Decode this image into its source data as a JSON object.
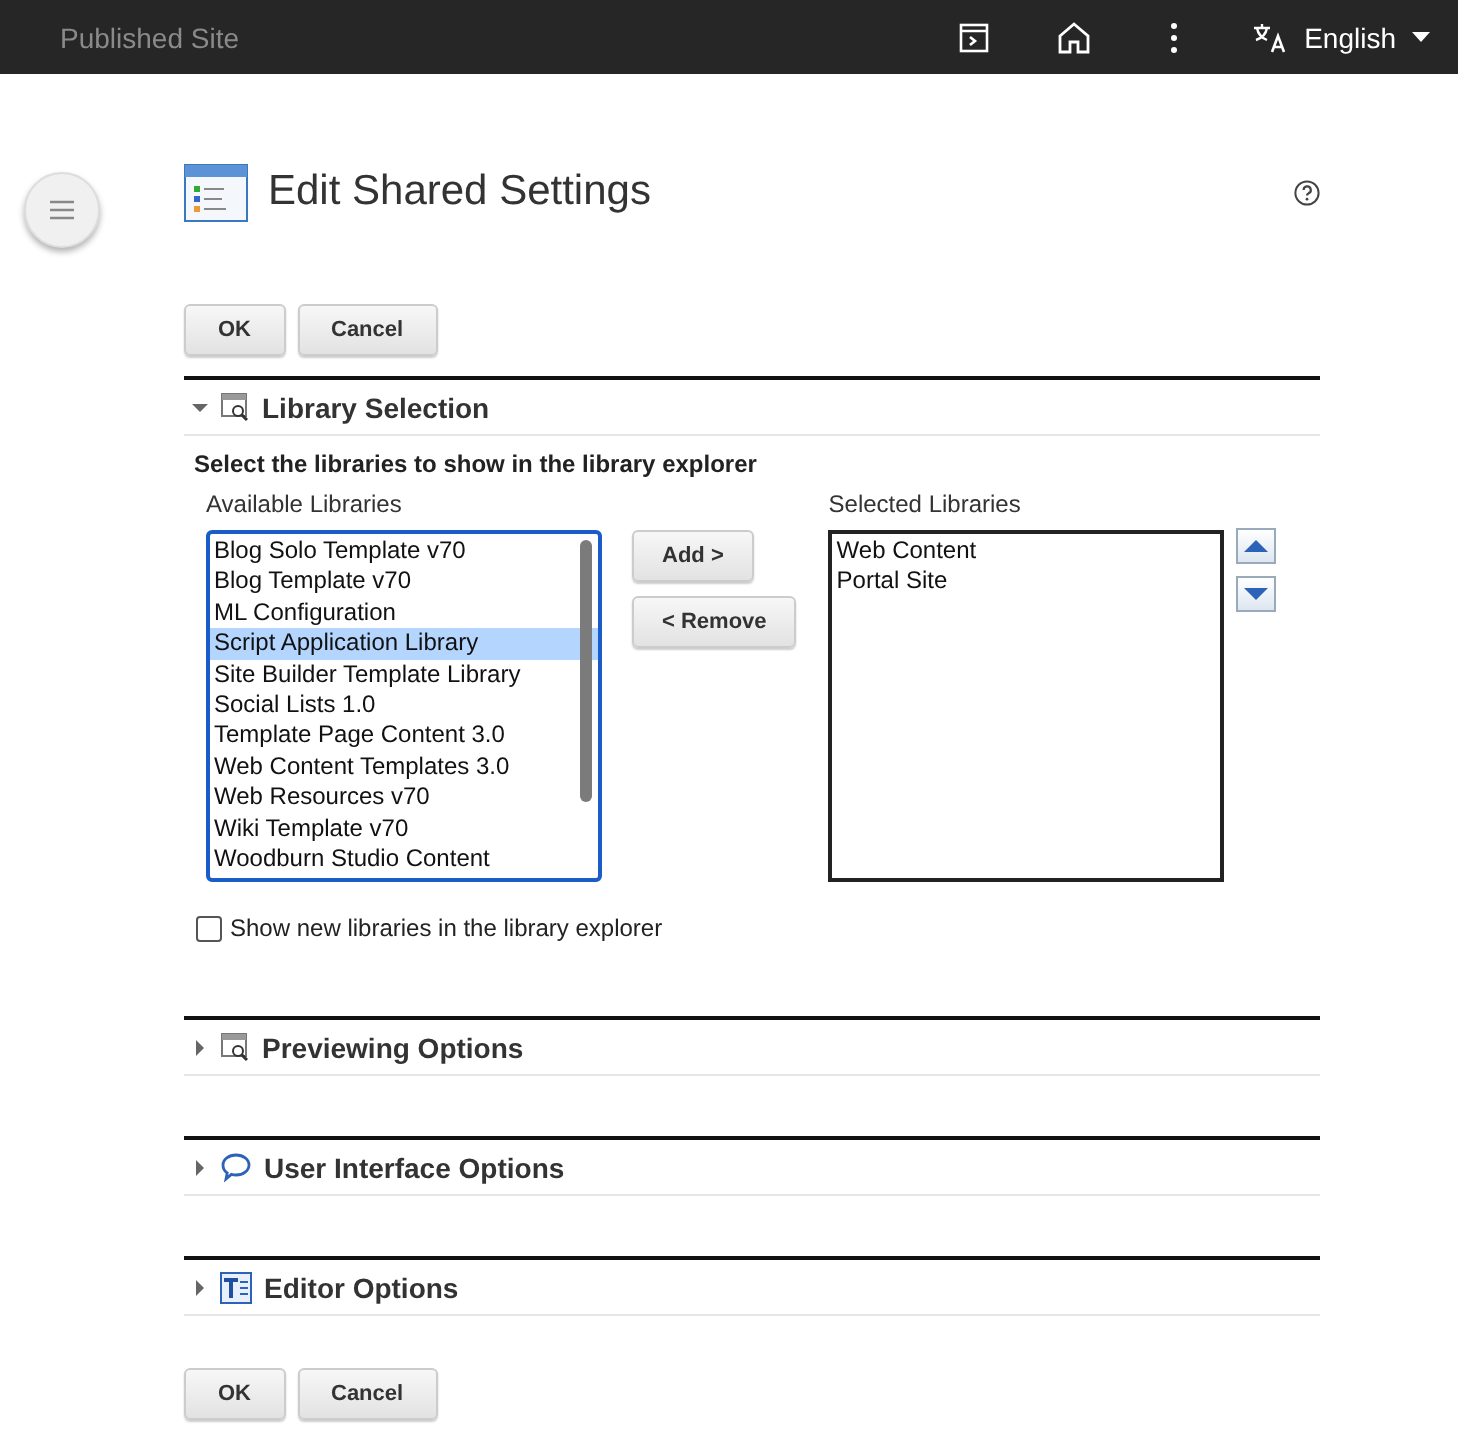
{
  "top_bar": {
    "site_name": "Published Site",
    "language": "English"
  },
  "title": "Edit Shared Settings",
  "buttons_top": [
    "OK",
    "Cancel"
  ],
  "sections": [
    {
      "title": "Library Selection",
      "kind": "preview",
      "expanded": true
    },
    {
      "title": "Previewing Options",
      "kind": "preview",
      "expanded": false
    },
    {
      "title": "User Interface Options",
      "kind": "interface",
      "expanded": false
    },
    {
      "title": "Editor Options",
      "kind": "editor",
      "expanded": false
    }
  ],
  "library_selection": {
    "instruction": "Select the libraries to show in the library explorer",
    "available_label": "Available Libraries",
    "available": [
      {
        "label": "Blog Solo Template v70",
        "selected": false
      },
      {
        "label": "Blog Template v70",
        "selected": false
      },
      {
        "label": "ML Configuration",
        "selected": false
      },
      {
        "label": "Script Application Library",
        "selected": true
      },
      {
        "label": "Site Builder Template Library",
        "selected": false
      },
      {
        "label": "Social Lists 1.0",
        "selected": false
      },
      {
        "label": "Template Page Content 3.0",
        "selected": false
      },
      {
        "label": "Web Content Templates 3.0",
        "selected": false
      },
      {
        "label": "Web Resources v70",
        "selected": false
      },
      {
        "label": "Wiki Template v70",
        "selected": false
      },
      {
        "label": "Woodburn Studio Content",
        "selected": false
      }
    ],
    "add_button": "Add >",
    "remove_button": "< Remove",
    "selected_label": "Selected Libraries",
    "selected": [
      {
        "label": "Web Content",
        "selected": false
      },
      {
        "label": "Portal Site",
        "selected": false
      }
    ],
    "show_new": {
      "label": "Show new libraries in the library explorer",
      "checked": false
    }
  },
  "buttons_bottom": [
    "OK",
    "Cancel"
  ]
}
